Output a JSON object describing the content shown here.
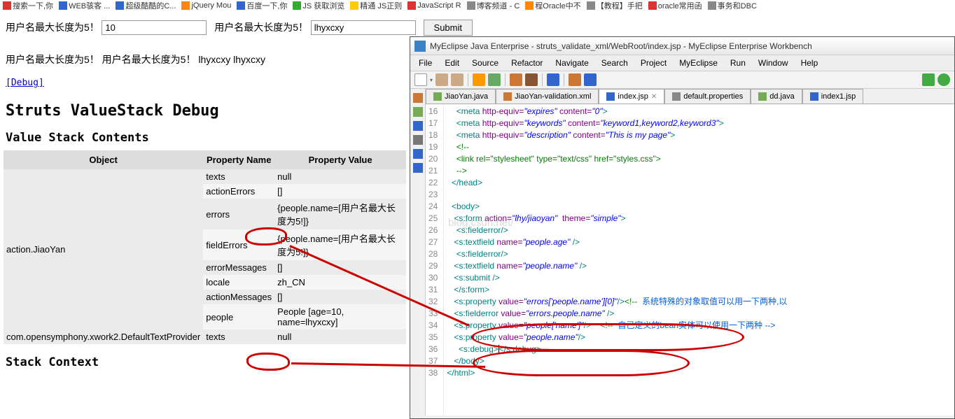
{
  "bookmarks": [
    {
      "icon": "red",
      "label": "搜索一下,你"
    },
    {
      "icon": "blue",
      "label": "WEB骇客 ..."
    },
    {
      "icon": "blue",
      "label": "超级酷酷的C..."
    },
    {
      "icon": "orange",
      "label": "jQuery Mou"
    },
    {
      "icon": "blue",
      "label": "百度一下,你"
    },
    {
      "icon": "green",
      "label": "JS 获取浏览"
    },
    {
      "icon": "yellow",
      "label": "精通 JS正则"
    },
    {
      "icon": "red",
      "label": "JavaScript R"
    },
    {
      "icon": "gray",
      "label": "博客频道 - C"
    },
    {
      "icon": "orange",
      "label": "程Oracle中不"
    },
    {
      "icon": "gray",
      "label": "【教程】手把"
    },
    {
      "icon": "red",
      "label": "oracle常用函"
    },
    {
      "icon": "gray",
      "label": "事务和DBC"
    }
  ],
  "form": {
    "label1": "用户名最大长度为5！",
    "input1_value": "10",
    "label2": "用户名最大长度为5！",
    "input2_value": "lhyxcxy",
    "submit": "Submit"
  },
  "output_line": "用户名最大长度为5！ 用户名最大长度为5！ lhyxcxy lhyxcxy",
  "debug_link": "[Debug]",
  "debug_title": "Struts ValueStack Debug",
  "section_title": "Value Stack Contents",
  "stack_context": "Stack Context",
  "table": {
    "headers": [
      "Object",
      "Property Name",
      "Property Value"
    ],
    "objects": [
      {
        "object": "action.JiaoYan",
        "props": [
          {
            "name": "texts",
            "value": "null"
          },
          {
            "name": "actionErrors",
            "value": "[]"
          },
          {
            "name": "errors",
            "value": "{people.name=[用户名最大长度为5!]}"
          },
          {
            "name": "fieldErrors",
            "value": "{people.name=[用户名最大长度为5!]}"
          },
          {
            "name": "errorMessages",
            "value": "[]"
          },
          {
            "name": "locale",
            "value": "zh_CN"
          },
          {
            "name": "actionMessages",
            "value": "[]"
          },
          {
            "name": "people",
            "value": "People [age=10, name=lhyxcxy]"
          }
        ]
      },
      {
        "object": "com.opensymphony.xwork2.DefaultTextProvider",
        "props": [
          {
            "name": "texts",
            "value": "null"
          }
        ]
      }
    ]
  },
  "ide": {
    "title": "MyEclipse Java Enterprise - struts_validate_xml/WebRoot/index.jsp - MyEclipse Enterprise Workbench",
    "menus": [
      "File",
      "Edit",
      "Source",
      "Refactor",
      "Navigate",
      "Search",
      "Project",
      "MyEclipse",
      "Run",
      "Window",
      "Help"
    ],
    "tabs": [
      {
        "label": "JiaoYan.java",
        "active": false,
        "icon": "#7a5"
      },
      {
        "label": "JiaoYan-validation.xml",
        "active": false,
        "icon": "#c73"
      },
      {
        "label": "index.jsp",
        "active": true,
        "icon": "#36c",
        "close": "✕"
      },
      {
        "label": "default.properties",
        "active": false,
        "icon": "#888"
      },
      {
        "label": "dd.java",
        "active": false,
        "icon": "#7a5"
      },
      {
        "label": "index1.jsp",
        "active": false,
        "icon": "#36c"
      }
    ],
    "line_start": 16,
    "line_end": 38,
    "comment1": "系统特殊的对象取值可以用一下两种,以",
    "comment2": "自己定义的bean实体可以使用一下两种 -->"
  },
  "watermark": "blog.csdn.net/"
}
